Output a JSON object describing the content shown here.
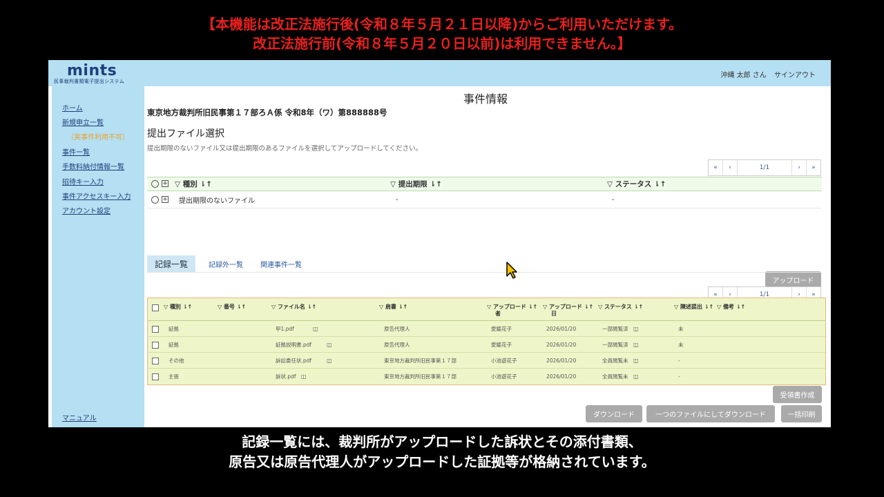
{
  "captions": {
    "top_line1": "【本機能は改正法施行後(令和８年５月２１日以降)からご利用いただけます。",
    "top_line2": "改正法施行前(令和８年５月２０日以前)は利用できません。】",
    "bottom_line1": "記録一覧には、裁判所がアップロードした訴状とその添付書類、",
    "bottom_line2": "原告又は原告代理人がアップロードした証拠等が格納されています。"
  },
  "header": {
    "logo": "mints",
    "logo_subtitle": "民事裁判書類電子提出システム",
    "user": "沖縄 太郎 さん",
    "signout": "サインアウト"
  },
  "sidebar": {
    "items": [
      {
        "label": "ホーム"
      },
      {
        "label": "新規申立一覧"
      },
      {
        "label": "（実事件利用不可）"
      },
      {
        "label": "事件一覧"
      },
      {
        "label": "手数料納付情報一覧"
      },
      {
        "label": "招待キー入力"
      },
      {
        "label": "事件アクセスキー入力"
      },
      {
        "label": "アカウント設定"
      }
    ],
    "manual": "マニュアル"
  },
  "main": {
    "page_title": "事件情報",
    "case_title": "東京地方裁判所旧民事第１７部ろＡ係 令和8年（ワ）第888888号",
    "section_title": "提出ファイル選択",
    "instruction": "提出期限のないファイル又は提出期限のあるファイルを選択してアップロードしてください。",
    "pager": {
      "first": "«",
      "prev": "‹",
      "page": "1/1",
      "next": "›",
      "last": "»"
    },
    "upload_table": {
      "headers": {
        "type": "▽ 種別 ⇂↑",
        "deadline": "▽ 提出期限 ⇂↑",
        "status": "▽ ステータス ⇂↑"
      },
      "row": {
        "type": "提出期限のないファイル",
        "deadline": "-",
        "status": "-"
      }
    },
    "upload_button": "アップロード",
    "tabs": [
      "記録一覧",
      "記録外一覧",
      "関連事件一覧"
    ],
    "records": {
      "headers": {
        "type": "▽ 種別 ⇂↑",
        "number": "▽ 番号 ⇂↑",
        "filename": "▽ ファイル名 ⇂↑",
        "doc": "▽ 肩書 ⇂↑",
        "uploader_1": "▽ アップロード ⇂↑",
        "uploader_2": "者",
        "date_1": "▽ アップロード ⇂↑",
        "date_2": "日",
        "status": "▽ ステータス ⇂↑",
        "submitted": "▽ 陳述提出 ⇂↑",
        "notes": "▽ 備考 ⇂↑"
      },
      "rows": [
        {
          "type": "証拠",
          "filename": "甲1.pdf",
          "doc": "原告代理人",
          "uploader": "愛媛花子",
          "date": "2026/01/20",
          "status": "一部閲覧済",
          "submitted": "未"
        },
        {
          "type": "証拠",
          "filename": "証拠説明書.pdf",
          "doc": "原告代理人",
          "uploader": "愛媛花子",
          "date": "2026/01/20",
          "status": "一部閲覧済",
          "submitted": "未"
        },
        {
          "type": "その他",
          "filename": "訴訟委任状.pdf",
          "doc": "東京地方裁判所旧民事第１７部",
          "uploader": "小池遊花子",
          "date": "2026/01/20",
          "status": "全員閲覧未",
          "submitted": "-"
        },
        {
          "type": "主張",
          "filename": "訴状.pdf",
          "doc": "東京地方裁判所旧民事第１７部",
          "uploader": "小池遊花子",
          "date": "2026/01/20",
          "status": "全員閲覧未",
          "submitted": "-"
        }
      ]
    },
    "buttons": {
      "receipt": "受領書作成",
      "download": "ダウンロード",
      "download_one": "一つのファイルにしてダウンロード",
      "print_all": "一括印刷"
    }
  }
}
